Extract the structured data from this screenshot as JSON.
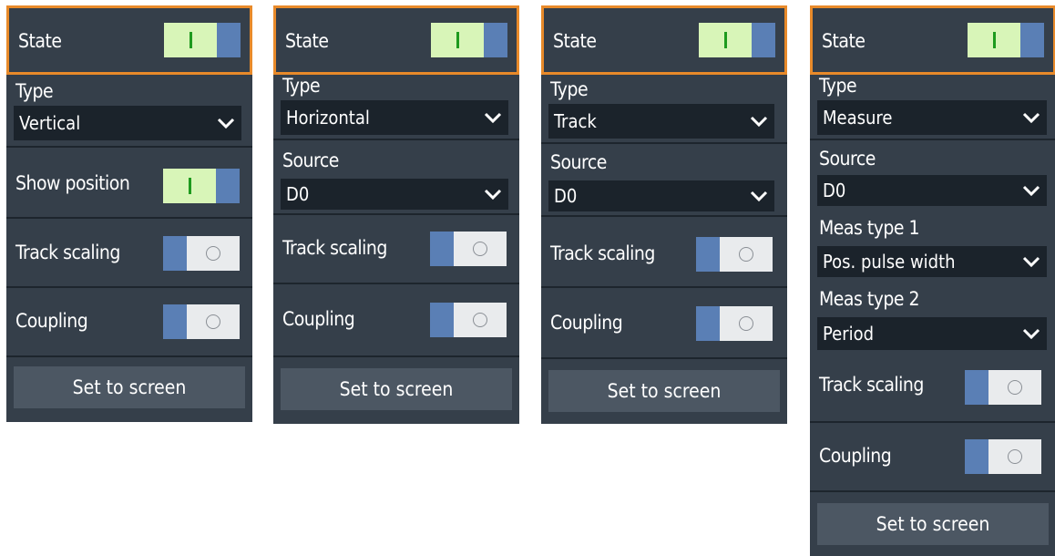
{
  "panels": [
    {
      "state_label": "State",
      "type_label": "Type",
      "type_value": "Vertical",
      "show_position_label": "Show position",
      "track_scaling_label": "Track scaling",
      "coupling_label": "Coupling",
      "button_label": "Set to screen"
    },
    {
      "state_label": "State",
      "type_label": "Type",
      "type_value": "Horizontal",
      "source_label": "Source",
      "source_value": "D0",
      "track_scaling_label": "Track scaling",
      "coupling_label": "Coupling",
      "button_label": "Set to screen"
    },
    {
      "state_label": "State",
      "type_label": "Type",
      "type_value": "Track",
      "source_label": "Source",
      "source_value": "D0",
      "track_scaling_label": "Track scaling",
      "coupling_label": "Coupling",
      "button_label": "Set to screen"
    },
    {
      "state_label": "State",
      "type_label": "Type",
      "type_value": "Measure",
      "source_label": "Source",
      "source_value": "D0",
      "meas1_label": "Meas type 1",
      "meas1_value": "Pos. pulse width",
      "meas2_label": "Meas type 2",
      "meas2_value": "Period",
      "track_scaling_label": "Track scaling",
      "coupling_label": "Coupling",
      "button_label": "Set to screen"
    }
  ],
  "colors": {
    "panel_bg": "#353f4a",
    "accent_border": "#e88a2a",
    "toggle_on": "#d8f5b8",
    "toggle_blue": "#5a7fb5"
  },
  "icons": [
    "chevron-down-icon",
    "toggle-on-icon",
    "toggle-off-icon"
  ]
}
